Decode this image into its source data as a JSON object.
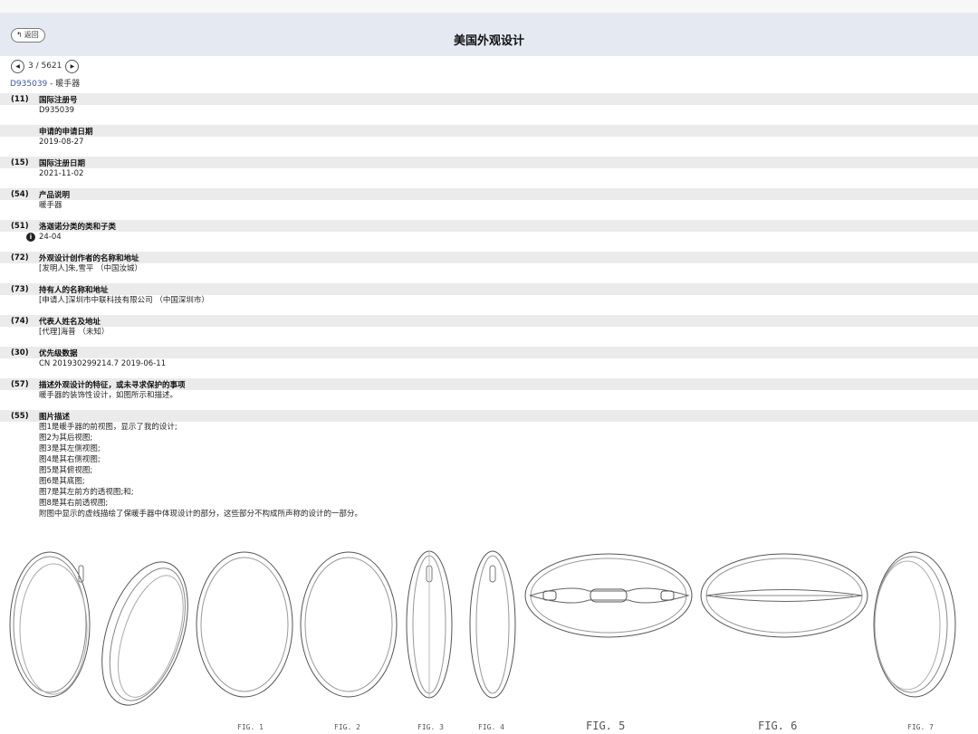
{
  "header": {
    "back_label": "返回",
    "title": "美国外观设计"
  },
  "pager": {
    "count_text": "3 / 5621"
  },
  "document": {
    "link_text": "D935039",
    "separator": " - ",
    "name": "暖手器"
  },
  "fields": [
    {
      "code": "(11)",
      "label": "国际注册号",
      "value": "D935039"
    },
    {
      "code": "",
      "label": "申请的申请日期",
      "value": "2019-08-27"
    },
    {
      "code": "(15)",
      "label": "国际注册日期",
      "value": "2021-11-02"
    },
    {
      "code": "(54)",
      "label": "产品说明",
      "value": "暖手器"
    },
    {
      "code": "(51)",
      "label": "洛迦诺分类的类和子类",
      "value": "24-04"
    },
    {
      "code": "(72)",
      "label": "外观设计创作者的名称和地址",
      "value": "[发明人]朱,雪平 （中国汝城）"
    },
    {
      "code": "(73)",
      "label": "持有人的名称和地址",
      "value": "[申请人]深圳市中联科技有限公司 （中国深圳市）"
    },
    {
      "code": "(74)",
      "label": "代表人姓名及地址",
      "value": "[代理]海普 （未知）"
    },
    {
      "code": "(30)",
      "label": "优先级数据",
      "value": "CN 201930299214.7 2019-06-11"
    },
    {
      "code": "(57)",
      "label": "描述外观设计的特征，或未寻求保护的事项",
      "value": "暖手器的装饰性设计，如图所示和描述。"
    },
    {
      "code": "(55)",
      "label": "图片描述",
      "value": ""
    }
  ],
  "figure_description_lines": [
    "图1是暖手器的前视图，显示了我的设计;",
    "图2为其后视图;",
    "图3是其左侧视图;",
    "图4是其右侧视图;",
    "图5是其俯视图;",
    "图6是其底图;",
    "图7是其左前方的透视图;和;",
    "图8是其右前透视图;",
    "附图中显示的虚线描绘了保暖手器中体现设计的部分，这些部分不构成所声称的设计的一部分。"
  ],
  "figure_labels": {
    "fig1": "FIG. 1",
    "fig2": "FIG. 2",
    "fig3": "FIG. 3",
    "fig4": "FIG. 4",
    "fig5": "FIG. 5",
    "fig6": "FIG. 6",
    "fig7": "FIG. 7"
  },
  "icons": {
    "back": "back-arrow-icon",
    "prev": "prev-arrow-icon",
    "next": "next-arrow-icon",
    "info": "info-icon"
  }
}
